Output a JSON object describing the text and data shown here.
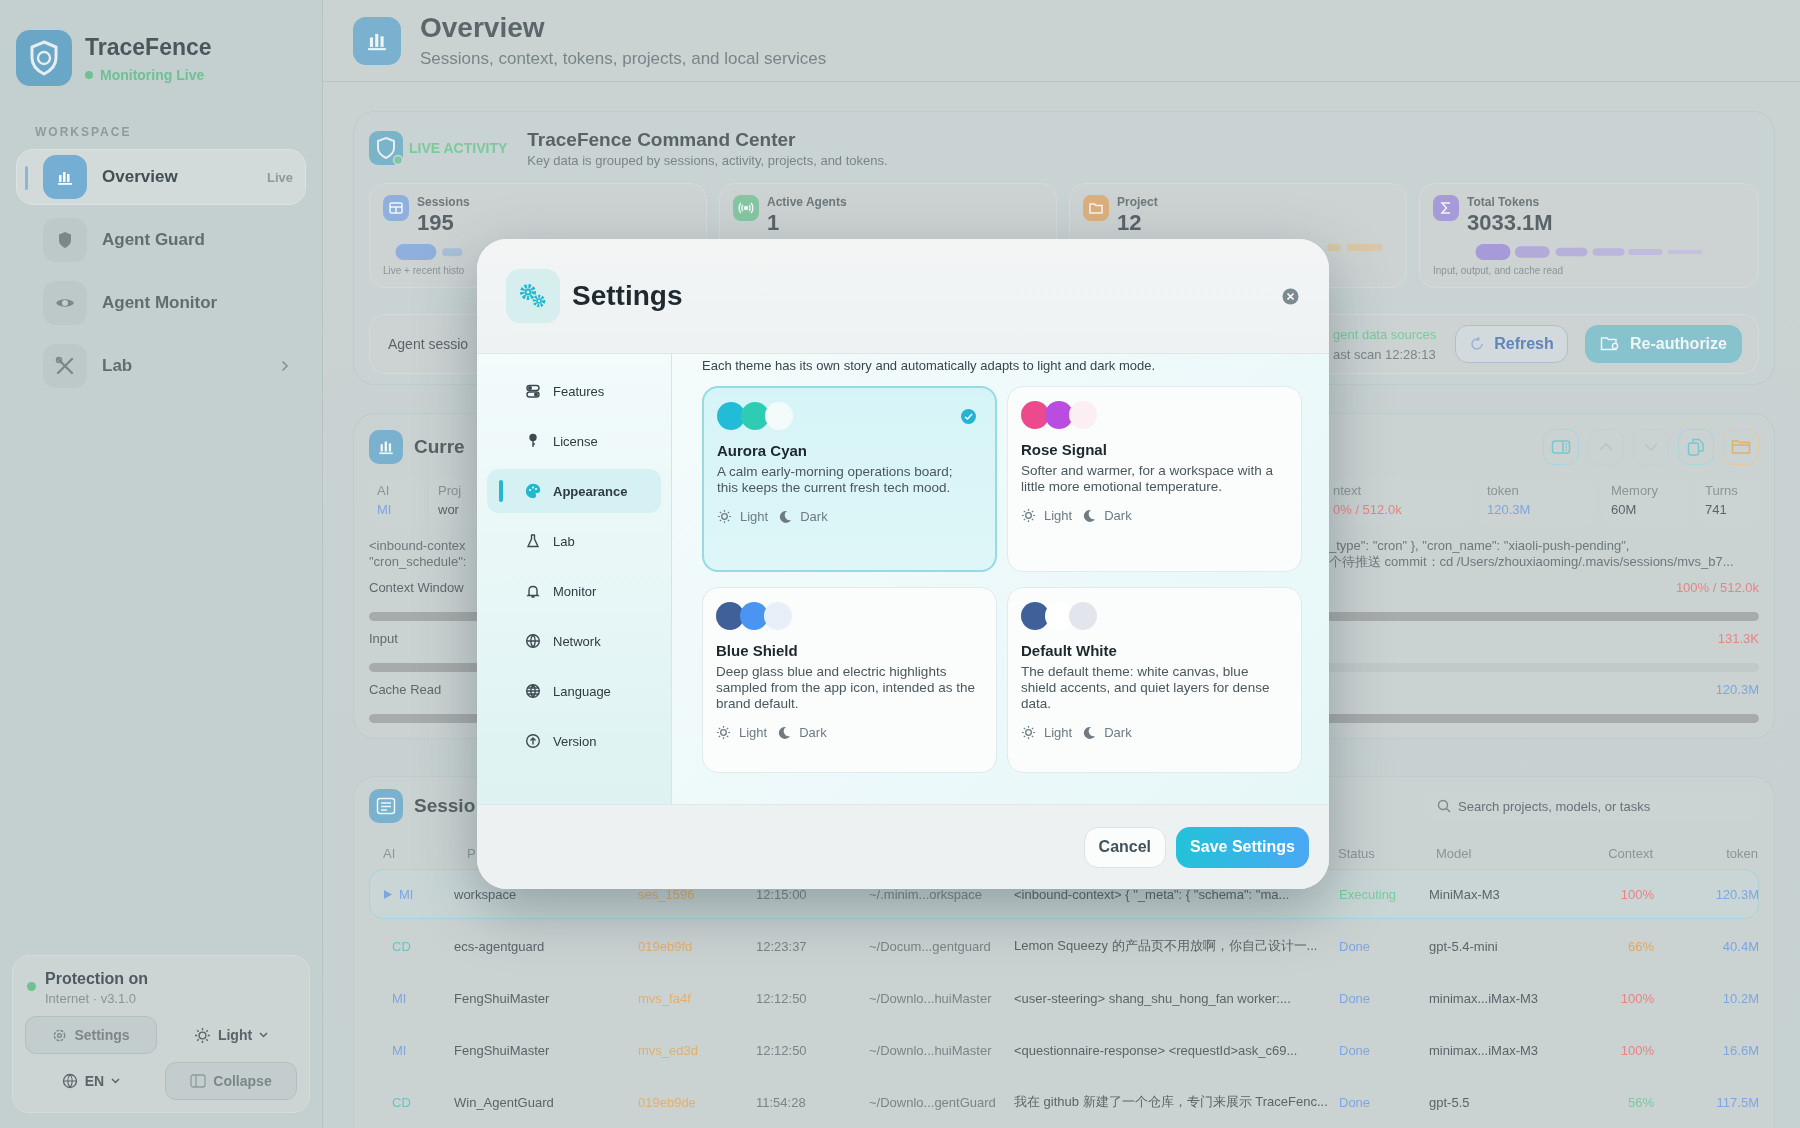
{
  "sidebar": {
    "brand": "TraceFence",
    "status": "Monitoring Live",
    "section": "WORKSPACE",
    "items": [
      {
        "label": "Overview",
        "kind": "chart",
        "badge": "Live",
        "selected": true,
        "expandable": false
      },
      {
        "label": "Agent Guard",
        "kind": "shield",
        "selected": false,
        "expandable": false
      },
      {
        "label": "Agent Monitor",
        "kind": "eye",
        "selected": false,
        "expandable": false
      },
      {
        "label": "Lab",
        "kind": "tools",
        "selected": false,
        "expandable": true
      }
    ],
    "protection": {
      "title": "Protection on",
      "on": true,
      "subtitle": "Internet · v3.1.0"
    },
    "settings_button": "Settings",
    "theme_button": "Light",
    "language_button": "EN",
    "collapse_button": "Collapse"
  },
  "header": {
    "title": "Overview",
    "subtitle": "Sessions, context, tokens, projects, and local services"
  },
  "live_activity": {
    "tag": "LIVE ACTIVITY",
    "title": "TraceFence Command Center",
    "subtitle": "Key data is grouped by sessions, activity, projects, and tokens.",
    "stats": [
      {
        "kind": "sessions",
        "label": "Sessions",
        "value": "195",
        "caption": "Live + recent histo"
      },
      {
        "kind": "agents",
        "label": "Active Agents",
        "value": "1"
      },
      {
        "kind": "projects",
        "label": "Project",
        "value": "12"
      },
      {
        "kind": "tokens",
        "label": "Total Tokens",
        "value": "3033.1M",
        "caption": "Input, output, and cache read"
      }
    ],
    "sessions_label": "Agent sessio",
    "sources_status": "gent data sources",
    "last_scan": "ast scan 12:28:13",
    "refresh_button": "Refresh",
    "reauthorize_button": "Re-authorize"
  },
  "current": {
    "title": "Curre",
    "fields_left": [
      {
        "label": "AI",
        "value": "MI",
        "color": "#7ea6e0"
      },
      {
        "label": "Proj",
        "value": "wor",
        "color": "#5b6569"
      }
    ],
    "fields_right": [
      {
        "label": "ntext",
        "value": "0% / 512.0k",
        "color": "#e58585"
      },
      {
        "label": "token",
        "value": "120.3M",
        "color": "#7ea6e0"
      },
      {
        "label": "Memory",
        "value": "60M",
        "color": "#5b6569"
      },
      {
        "label": "Turns",
        "value": "741",
        "color": "#5b6569"
      }
    ],
    "prompt_left": [
      "<inbound-contex",
      "\"cron_schedule\":"
    ],
    "prompt_right": [
      "_type\": \"cron\" }, \"cron_name\": \"xiaoli-push-pending\",",
      "个待推送 commit：cd /Users/zhouxiaoming/.mavis/sessions/mvs_b7..."
    ],
    "meters": [
      {
        "label": "Context Window",
        "reading": "100% / 512.0k",
        "color": "#e58585",
        "level": 1
      },
      {
        "label": "Input",
        "reading": "131.3K",
        "color": "#e58585",
        "level": 0.26
      },
      {
        "label": "Cache Read",
        "reading": "120.3M",
        "color": "#7ea6e0",
        "level": 1
      }
    ]
  },
  "sessions": {
    "title": "Sessio",
    "search": {
      "placeholder": "Search projects, models, or tasks"
    },
    "columns": [
      "AI",
      "P",
      "Status",
      "Model",
      "Context",
      "token"
    ],
    "rows": [
      {
        "selected": true,
        "ai": {
          "text": "MI",
          "color": "#7ea6e0"
        },
        "project": "workspace",
        "id": "ses_1596",
        "time": "12:15:00",
        "path": "~/.minim...orkspace",
        "task": "<inbound-context> { \"_meta\": { \"schema\": \"ma...",
        "status": {
          "text": "Executing",
          "kind": "running"
        },
        "model": "MiniMax-M3",
        "context": {
          "text": "100%",
          "color": "#e58585"
        },
        "token": "120.3M"
      },
      {
        "selected": false,
        "ai": {
          "text": "CD",
          "color": "#6cc2c6"
        },
        "project": "ecs-agentguard",
        "id": "019eb9fd",
        "time": "12:23:37",
        "path": "~/Docum...gentguard",
        "task": "Lemon Squeezy 的产品页不用放啊，你自己设计一...",
        "status": {
          "text": "Done",
          "kind": "done"
        },
        "model": "gpt-5.4-mini",
        "context": {
          "text": "66%",
          "color": "#e0a860"
        },
        "token": "40.4M"
      },
      {
        "selected": false,
        "ai": {
          "text": "MI",
          "color": "#7ea6e0"
        },
        "project": "FengShuiMaster",
        "id": "mvs_fa4f",
        "time": "12:12:50",
        "path": "~/Downlo...huiMaster",
        "task": "<user-steering> shang_shu_hong_fan worker:...",
        "status": {
          "text": "Done",
          "kind": "done"
        },
        "model": "minimax...iMax-M3",
        "context": {
          "text": "100%",
          "color": "#e58585"
        },
        "token": "10.2M"
      },
      {
        "selected": false,
        "ai": {
          "text": "MI",
          "color": "#7ea6e0"
        },
        "project": "FengShuiMaster",
        "id": "mvs_ed3d",
        "time": "12:12:50",
        "path": "~/Downlo...huiMaster",
        "task": "<questionnaire-response> <requestId>ask_c69...",
        "status": {
          "text": "Done",
          "kind": "done"
        },
        "model": "minimax...iMax-M3",
        "context": {
          "text": "100%",
          "color": "#e58585"
        },
        "token": "16.6M"
      },
      {
        "selected": false,
        "ai": {
          "text": "CD",
          "color": "#6cc2c6"
        },
        "project": "Win_AgentGuard",
        "id": "019eb9de",
        "time": "11:54:28",
        "path": "~/Downlo...gentGuard",
        "task": "我在 github 新建了一个仓库，专门来展示 TraceFenc...",
        "status": {
          "text": "Done",
          "kind": "done"
        },
        "model": "gpt-5.5",
        "context": {
          "text": "56%",
          "color": "#7ccaa0"
        },
        "token": "117.5M"
      }
    ]
  },
  "settings_dialog": {
    "title": "Settings",
    "nav": [
      {
        "label": "Features",
        "kind": "toggles",
        "selected": false
      },
      {
        "label": "License",
        "kind": "key",
        "selected": false
      },
      {
        "label": "Appearance",
        "kind": "palette",
        "selected": true
      },
      {
        "label": "Lab",
        "kind": "flask",
        "selected": false
      },
      {
        "label": "Monitor",
        "kind": "bell",
        "selected": false
      },
      {
        "label": "Network",
        "kind": "network",
        "selected": false
      },
      {
        "label": "Language",
        "kind": "globe",
        "selected": false
      },
      {
        "label": "Version",
        "kind": "upgrade",
        "selected": false
      }
    ],
    "intro": "Each theme has its own story and automatically adapts to light and dark mode.",
    "themes": [
      {
        "name": "Aurora Cyan",
        "description": "A calm early-morning operations board; this keeps the current fresh tech mood.",
        "selected": true,
        "swatches": [
          {
            "color": "#22bcd8"
          },
          {
            "color": "#2ecdb3"
          },
          {
            "color": "#f4fbfb"
          }
        ],
        "light_label": "Light",
        "dark_label": "Dark"
      },
      {
        "name": "Rose Signal",
        "description": "Softer and warmer, for a workspace with a little more emotional temperature.",
        "selected": false,
        "swatches": [
          {
            "color": "#ec4a8c"
          },
          {
            "color": "#b84de0"
          },
          {
            "color": "#fbeff4"
          }
        ],
        "light_label": "Light",
        "dark_label": "Dark"
      },
      {
        "name": "Blue Shield",
        "description": "Deep glass blue and electric highlights sampled from the app icon, intended as the brand default.",
        "selected": false,
        "swatches": [
          {
            "color": "#40609a"
          },
          {
            "color": "#4a94f2"
          },
          {
            "color": "#e9eff8"
          }
        ],
        "light_label": "Light",
        "dark_label": "Dark"
      },
      {
        "name": "Default White",
        "description": "The default theme: white canvas, blue shield accents, and quiet layers for dense data.",
        "selected": false,
        "swatches": [
          {
            "color": "#40609a"
          },
          {
            "color": "#ffffff"
          },
          {
            "color": "#e2e6ec"
          }
        ],
        "light_label": "Light",
        "dark_label": "Dark"
      }
    ],
    "cancel_button": "Cancel",
    "save_button": "Save Settings"
  }
}
